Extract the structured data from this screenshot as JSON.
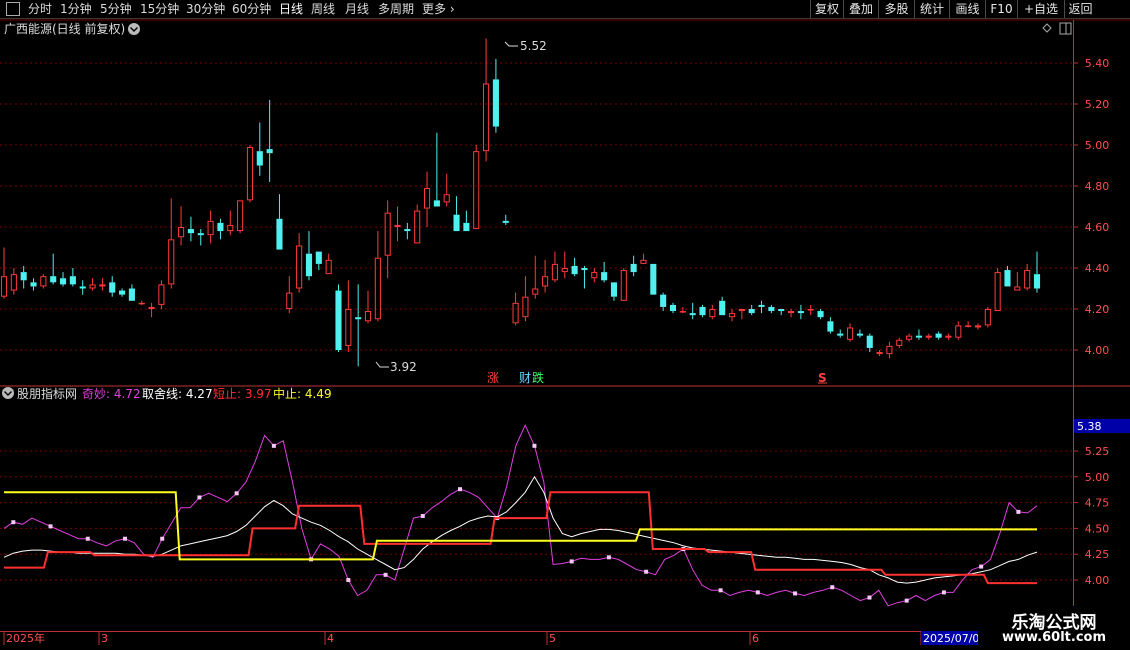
{
  "toolbar": {
    "periods": [
      "分时",
      "1分钟",
      "5分钟",
      "15分钟",
      "30分钟",
      "60分钟",
      "日线",
      "周线",
      "月线",
      "多周期"
    ],
    "active_period": "日线",
    "more": "更多",
    "right_buttons": [
      "复权",
      "叠加",
      "多股",
      "统计",
      "画线",
      "F10",
      "+自选",
      "返回"
    ]
  },
  "stock": {
    "title": "广西能源(日线 前复权)"
  },
  "indicator": {
    "name": "股朋指标网",
    "lines": [
      {
        "label": "奇妙: 4.72",
        "color": "#e040e0"
      },
      {
        "label": "取舍线: 4.27",
        "color": "#ffffff"
      },
      {
        "label": "短止: 3.97",
        "color": "#ff3030"
      },
      {
        "label": "中止: 4.49",
        "color": "#ffff20"
      }
    ],
    "current_value": "5.38"
  },
  "colors": {
    "up": "#ff3b3b",
    "down": "#4ef0f0",
    "grid": "#7a0000",
    "axis": "#c03030",
    "price_axis_text": "#ff5050"
  },
  "price_axis": {
    "labels": [
      "5.40",
      "5.20",
      "5.00",
      "4.80",
      "4.60",
      "4.40",
      "4.20",
      "4.00"
    ],
    "values": [
      5.4,
      5.2,
      5.0,
      4.8,
      4.6,
      4.4,
      4.2,
      4.0
    ]
  },
  "indicator_axis": {
    "labels": [
      "5.25",
      "5.00",
      "4.75",
      "4.50",
      "4.25",
      "4.00"
    ],
    "values": [
      5.25,
      5.0,
      4.75,
      4.5,
      4.25,
      4.0
    ]
  },
  "annotations": {
    "high": "5.52",
    "low": "3.92",
    "zhang": "涨",
    "cai": "财",
    "die": "跌",
    "s_mark": "S"
  },
  "date_axis": {
    "labels": [
      "2025年",
      "3",
      "4",
      "5",
      "6",
      "2025/07/0"
    ]
  },
  "watermark": {
    "line1": "乐淘公式网",
    "line2": "www.60lt.com"
  },
  "chart_data": {
    "type": "candlestick",
    "ylim": [
      3.85,
      5.57
    ],
    "candles": [
      {
        "o": 4.26,
        "h": 4.5,
        "l": 4.25,
        "c": 4.36
      },
      {
        "o": 4.29,
        "h": 4.4,
        "l": 4.27,
        "c": 4.37
      },
      {
        "o": 4.38,
        "h": 4.41,
        "l": 4.3,
        "c": 4.34
      },
      {
        "o": 4.33,
        "h": 4.35,
        "l": 4.29,
        "c": 4.31
      },
      {
        "o": 4.31,
        "h": 4.37,
        "l": 4.3,
        "c": 4.36
      },
      {
        "o": 4.36,
        "h": 4.47,
        "l": 4.32,
        "c": 4.33
      },
      {
        "o": 4.35,
        "h": 4.38,
        "l": 4.31,
        "c": 4.32
      },
      {
        "o": 4.36,
        "h": 4.4,
        "l": 4.31,
        "c": 4.32
      },
      {
        "o": 4.31,
        "h": 4.34,
        "l": 4.27,
        "c": 4.3
      },
      {
        "o": 4.3,
        "h": 4.35,
        "l": 4.29,
        "c": 4.32
      },
      {
        "o": 4.31,
        "h": 4.35,
        "l": 4.29,
        "c": 4.32
      },
      {
        "o": 4.33,
        "h": 4.36,
        "l": 4.26,
        "c": 4.28
      },
      {
        "o": 4.29,
        "h": 4.3,
        "l": 4.26,
        "c": 4.27
      },
      {
        "o": 4.3,
        "h": 4.32,
        "l": 4.24,
        "c": 4.24
      },
      {
        "o": 4.23,
        "h": 4.24,
        "l": 4.22,
        "c": 4.23
      },
      {
        "o": 4.2,
        "h": 4.23,
        "l": 4.16,
        "c": 4.21
      },
      {
        "o": 4.22,
        "h": 4.34,
        "l": 4.2,
        "c": 4.32
      },
      {
        "o": 4.32,
        "h": 4.74,
        "l": 4.3,
        "c": 4.54
      },
      {
        "o": 4.55,
        "h": 4.7,
        "l": 4.51,
        "c": 4.6
      },
      {
        "o": 4.59,
        "h": 4.65,
        "l": 4.53,
        "c": 4.57
      },
      {
        "o": 4.57,
        "h": 4.59,
        "l": 4.51,
        "c": 4.56
      },
      {
        "o": 4.56,
        "h": 4.68,
        "l": 4.52,
        "c": 4.63
      },
      {
        "o": 4.62,
        "h": 4.64,
        "l": 4.54,
        "c": 4.58
      },
      {
        "o": 4.58,
        "h": 4.68,
        "l": 4.56,
        "c": 4.61
      },
      {
        "o": 4.58,
        "h": 4.73,
        "l": 4.57,
        "c": 4.73
      },
      {
        "o": 4.73,
        "h": 5.0,
        "l": 4.72,
        "c": 4.99
      },
      {
        "o": 4.97,
        "h": 5.11,
        "l": 4.85,
        "c": 4.9
      },
      {
        "o": 4.98,
        "h": 5.22,
        "l": 4.82,
        "c": 4.96
      },
      {
        "o": 4.64,
        "h": 4.76,
        "l": 4.5,
        "c": 4.49
      },
      {
        "o": 4.2,
        "h": 4.36,
        "l": 4.18,
        "c": 4.28
      },
      {
        "o": 4.3,
        "h": 4.57,
        "l": 4.28,
        "c": 4.51
      },
      {
        "o": 4.47,
        "h": 4.58,
        "l": 4.34,
        "c": 4.36
      },
      {
        "o": 4.48,
        "h": 4.48,
        "l": 4.39,
        "c": 4.42
      },
      {
        "o": 4.37,
        "h": 4.47,
        "l": 4.37,
        "c": 4.44
      },
      {
        "o": 4.29,
        "h": 4.32,
        "l": 3.99,
        "c": 4.0
      },
      {
        "o": 4.02,
        "h": 4.34,
        "l": 3.99,
        "c": 4.2
      },
      {
        "o": 4.16,
        "h": 4.32,
        "l": 3.92,
        "c": 4.15
      },
      {
        "o": 4.14,
        "h": 4.29,
        "l": 4.13,
        "c": 4.19
      },
      {
        "o": 4.15,
        "h": 4.58,
        "l": 4.14,
        "c": 4.45
      },
      {
        "o": 4.46,
        "h": 4.73,
        "l": 4.35,
        "c": 4.67
      },
      {
        "o": 4.6,
        "h": 4.7,
        "l": 4.53,
        "c": 4.61
      },
      {
        "o": 4.59,
        "h": 4.62,
        "l": 4.54,
        "c": 4.58
      },
      {
        "o": 4.52,
        "h": 4.71,
        "l": 4.52,
        "c": 4.68
      },
      {
        "o": 4.69,
        "h": 4.87,
        "l": 4.6,
        "c": 4.79
      },
      {
        "o": 4.73,
        "h": 5.06,
        "l": 4.7,
        "c": 4.7
      },
      {
        "o": 4.72,
        "h": 4.86,
        "l": 4.7,
        "c": 4.76
      },
      {
        "o": 4.66,
        "h": 4.75,
        "l": 4.58,
        "c": 4.58
      },
      {
        "o": 4.62,
        "h": 4.68,
        "l": 4.58,
        "c": 4.58
      },
      {
        "o": 4.59,
        "h": 5.0,
        "l": 4.59,
        "c": 4.97
      },
      {
        "o": 4.97,
        "h": 5.52,
        "l": 4.92,
        "c": 5.3
      },
      {
        "o": 5.32,
        "h": 5.42,
        "l": 5.06,
        "c": 5.09
      },
      {
        "o": 4.63,
        "h": 4.66,
        "l": 4.61,
        "c": 4.62
      },
      {
        "o": 4.13,
        "h": 4.28,
        "l": 4.12,
        "c": 4.23
      },
      {
        "o": 4.16,
        "h": 4.36,
        "l": 4.14,
        "c": 4.26
      },
      {
        "o": 4.27,
        "h": 4.46,
        "l": 4.25,
        "c": 4.3
      },
      {
        "o": 4.31,
        "h": 4.44,
        "l": 4.28,
        "c": 4.36
      },
      {
        "o": 4.34,
        "h": 4.48,
        "l": 4.33,
        "c": 4.42
      },
      {
        "o": 4.38,
        "h": 4.48,
        "l": 4.35,
        "c": 4.4
      },
      {
        "o": 4.41,
        "h": 4.45,
        "l": 4.36,
        "c": 4.37
      },
      {
        "o": 4.4,
        "h": 4.41,
        "l": 4.3,
        "c": 4.39
      },
      {
        "o": 4.35,
        "h": 4.4,
        "l": 4.33,
        "c": 4.38
      },
      {
        "o": 4.38,
        "h": 4.43,
        "l": 4.33,
        "c": 4.34
      },
      {
        "o": 4.33,
        "h": 4.33,
        "l": 4.24,
        "c": 4.26
      },
      {
        "o": 4.24,
        "h": 4.4,
        "l": 4.24,
        "c": 4.39
      },
      {
        "o": 4.42,
        "h": 4.46,
        "l": 4.36,
        "c": 4.38
      },
      {
        "o": 4.42,
        "h": 4.47,
        "l": 4.42,
        "c": 4.44
      },
      {
        "o": 4.42,
        "h": 4.42,
        "l": 4.27,
        "c": 4.27
      },
      {
        "o": 4.27,
        "h": 4.28,
        "l": 4.19,
        "c": 4.21
      },
      {
        "o": 4.22,
        "h": 4.23,
        "l": 4.18,
        "c": 4.19
      },
      {
        "o": 4.19,
        "h": 4.21,
        "l": 4.18,
        "c": 4.19
      },
      {
        "o": 4.18,
        "h": 4.23,
        "l": 4.15,
        "c": 4.17
      },
      {
        "o": 4.21,
        "h": 4.22,
        "l": 4.16,
        "c": 4.17
      },
      {
        "o": 4.16,
        "h": 4.22,
        "l": 4.15,
        "c": 4.2
      },
      {
        "o": 4.24,
        "h": 4.26,
        "l": 4.17,
        "c": 4.17
      },
      {
        "o": 4.16,
        "h": 4.2,
        "l": 4.14,
        "c": 4.18
      },
      {
        "o": 4.19,
        "h": 4.2,
        "l": 4.15,
        "c": 4.2
      },
      {
        "o": 4.2,
        "h": 4.22,
        "l": 4.17,
        "c": 4.18
      },
      {
        "o": 4.22,
        "h": 4.24,
        "l": 4.18,
        "c": 4.21
      },
      {
        "o": 4.21,
        "h": 4.22,
        "l": 4.18,
        "c": 4.19
      },
      {
        "o": 4.2,
        "h": 4.2,
        "l": 4.17,
        "c": 4.19
      },
      {
        "o": 4.18,
        "h": 4.2,
        "l": 4.16,
        "c": 4.19
      },
      {
        "o": 4.19,
        "h": 4.22,
        "l": 4.15,
        "c": 4.18
      },
      {
        "o": 4.2,
        "h": 4.22,
        "l": 4.17,
        "c": 4.2
      },
      {
        "o": 4.19,
        "h": 4.2,
        "l": 4.15,
        "c": 4.16
      },
      {
        "o": 4.14,
        "h": 4.16,
        "l": 4.08,
        "c": 4.09
      },
      {
        "o": 4.08,
        "h": 4.1,
        "l": 4.06,
        "c": 4.07
      },
      {
        "o": 4.05,
        "h": 4.13,
        "l": 4.04,
        "c": 4.11
      },
      {
        "o": 4.08,
        "h": 4.1,
        "l": 4.06,
        "c": 4.07
      },
      {
        "o": 4.07,
        "h": 4.08,
        "l": 3.99,
        "c": 4.01
      },
      {
        "o": 3.98,
        "h": 4.0,
        "l": 3.97,
        "c": 3.99
      },
      {
        "o": 3.98,
        "h": 4.04,
        "l": 3.96,
        "c": 4.02
      },
      {
        "o": 4.02,
        "h": 4.06,
        "l": 4.01,
        "c": 4.05
      },
      {
        "o": 4.05,
        "h": 4.08,
        "l": 4.04,
        "c": 4.07
      },
      {
        "o": 4.07,
        "h": 4.1,
        "l": 4.05,
        "c": 4.06
      },
      {
        "o": 4.06,
        "h": 4.08,
        "l": 4.05,
        "c": 4.07
      },
      {
        "o": 4.08,
        "h": 4.09,
        "l": 4.05,
        "c": 4.06
      },
      {
        "o": 4.06,
        "h": 4.08,
        "l": 4.05,
        "c": 4.07
      },
      {
        "o": 4.06,
        "h": 4.14,
        "l": 4.05,
        "c": 4.12
      },
      {
        "o": 4.12,
        "h": 4.14,
        "l": 4.11,
        "c": 4.12
      },
      {
        "o": 4.11,
        "h": 4.13,
        "l": 4.1,
        "c": 4.12
      },
      {
        "o": 4.12,
        "h": 4.21,
        "l": 4.11,
        "c": 4.2
      },
      {
        "o": 4.19,
        "h": 4.4,
        "l": 4.19,
        "c": 4.38
      },
      {
        "o": 4.39,
        "h": 4.41,
        "l": 4.31,
        "c": 4.31
      },
      {
        "o": 4.29,
        "h": 4.38,
        "l": 4.29,
        "c": 4.31
      },
      {
        "o": 4.3,
        "h": 4.42,
        "l": 4.29,
        "c": 4.39
      },
      {
        "o": 4.37,
        "h": 4.48,
        "l": 4.28,
        "c": 4.3
      }
    ],
    "indicator_ylim": [
      3.75,
      5.57
    ],
    "series": [
      {
        "name": "奇妙",
        "color": "#e040e0",
        "values": [
          4.5,
          4.56,
          4.54,
          4.6,
          4.56,
          4.52,
          4.48,
          4.44,
          4.4,
          4.4,
          4.36,
          4.33,
          4.38,
          4.4,
          4.36,
          4.25,
          4.22,
          4.4,
          4.55,
          4.7,
          4.7,
          4.8,
          4.84,
          4.8,
          4.76,
          4.84,
          4.95,
          5.15,
          5.4,
          5.3,
          5.35,
          4.95,
          4.5,
          4.2,
          4.35,
          4.3,
          4.23,
          4.0,
          3.85,
          3.9,
          4.05,
          4.05,
          4.0,
          4.3,
          4.6,
          4.62,
          4.7,
          4.76,
          4.83,
          4.88,
          4.85,
          4.8,
          4.7,
          4.6,
          4.9,
          5.3,
          5.5,
          5.3,
          4.95,
          4.15,
          4.16,
          4.18,
          4.21,
          4.2,
          4.2,
          4.22,
          4.2,
          4.15,
          4.1,
          4.08,
          4.05,
          4.2,
          4.24,
          4.3,
          4.1,
          3.95,
          3.9,
          3.9,
          3.85,
          3.88,
          3.9,
          3.88,
          3.85,
          3.88,
          3.9,
          3.87,
          3.85,
          3.88,
          3.9,
          3.93,
          3.9,
          3.85,
          3.8,
          3.83,
          3.9,
          3.75,
          3.78,
          3.8,
          3.85,
          3.8,
          3.85,
          3.88,
          3.88,
          4.0,
          4.1,
          4.13,
          4.2,
          4.45,
          4.75,
          4.66,
          4.65,
          4.72
        ]
      },
      {
        "name": "取舍线",
        "color": "#ffffff",
        "values": [
          4.22,
          4.26,
          4.28,
          4.29,
          4.29,
          4.28,
          4.27,
          4.27,
          4.26,
          4.26,
          4.26,
          4.26,
          4.26,
          4.25,
          4.25,
          4.24,
          4.23,
          4.25,
          4.29,
          4.33,
          4.35,
          4.37,
          4.39,
          4.41,
          4.43,
          4.47,
          4.53,
          4.62,
          4.71,
          4.77,
          4.72,
          4.64,
          4.6,
          4.56,
          4.53,
          4.48,
          4.42,
          4.37,
          4.3,
          4.25,
          4.2,
          4.15,
          4.1,
          4.12,
          4.2,
          4.3,
          4.37,
          4.43,
          4.48,
          4.52,
          4.57,
          4.6,
          4.62,
          4.61,
          4.66,
          4.75,
          4.85,
          5.0,
          4.85,
          4.6,
          4.45,
          4.42,
          4.45,
          4.47,
          4.49,
          4.49,
          4.48,
          4.46,
          4.44,
          4.42,
          4.4,
          4.38,
          4.36,
          4.33,
          4.31,
          4.3,
          4.29,
          4.28,
          4.27,
          4.26,
          4.25,
          4.24,
          4.23,
          4.22,
          4.22,
          4.21,
          4.2,
          4.2,
          4.19,
          4.18,
          4.17,
          4.15,
          4.12,
          4.1,
          4.05,
          4.02,
          3.98,
          3.97,
          3.98,
          4.0,
          4.02,
          4.03,
          4.04,
          4.05,
          4.06,
          4.08,
          4.1,
          4.14,
          4.18,
          4.2,
          4.24,
          4.27
        ]
      },
      {
        "name": "短止",
        "color": "#ff3030",
        "values": [
          4.12,
          4.12,
          4.12,
          4.12,
          4.12,
          4.27,
          4.27,
          4.27,
          4.27,
          4.27,
          4.24,
          4.24,
          4.24,
          4.24,
          4.24,
          4.24,
          4.24,
          4.24,
          4.24,
          4.24,
          4.24,
          4.24,
          4.24,
          4.24,
          4.24,
          4.24,
          4.24,
          4.5,
          4.5,
          4.5,
          4.5,
          4.5,
          4.72,
          4.72,
          4.72,
          4.72,
          4.72,
          4.72,
          4.72,
          4.35,
          4.35,
          4.35,
          4.35,
          4.35,
          4.35,
          4.35,
          4.35,
          4.35,
          4.35,
          4.35,
          4.35,
          4.35,
          4.35,
          4.6,
          4.6,
          4.6,
          4.6,
          4.6,
          4.6,
          4.85,
          4.85,
          4.85,
          4.85,
          4.85,
          4.85,
          4.85,
          4.85,
          4.85,
          4.85,
          4.85,
          4.3,
          4.3,
          4.3,
          4.3,
          4.3,
          4.3,
          4.27,
          4.27,
          4.27,
          4.27,
          4.27,
          4.1,
          4.1,
          4.1,
          4.1,
          4.1,
          4.1,
          4.1,
          4.1,
          4.1,
          4.1,
          4.1,
          4.1,
          4.1,
          4.1,
          4.05,
          4.05,
          4.05,
          4.05,
          4.05,
          4.05,
          4.05,
          4.05,
          4.05,
          4.05,
          4.05,
          3.97,
          3.97,
          3.97,
          3.97,
          3.97,
          3.97
        ]
      },
      {
        "name": "中止",
        "color": "#ffff20",
        "values": [
          4.85,
          4.85,
          4.85,
          4.85,
          4.85,
          4.85,
          4.85,
          4.85,
          4.85,
          4.85,
          4.85,
          4.85,
          4.85,
          4.85,
          4.85,
          4.85,
          4.85,
          4.85,
          4.85,
          4.2,
          4.2,
          4.2,
          4.2,
          4.2,
          4.2,
          4.2,
          4.2,
          4.2,
          4.2,
          4.2,
          4.2,
          4.2,
          4.2,
          4.2,
          4.2,
          4.2,
          4.2,
          4.2,
          4.2,
          4.2,
          4.38,
          4.38,
          4.38,
          4.38,
          4.38,
          4.38,
          4.38,
          4.38,
          4.38,
          4.38,
          4.38,
          4.38,
          4.38,
          4.38,
          4.38,
          4.38,
          4.38,
          4.38,
          4.38,
          4.38,
          4.38,
          4.38,
          4.38,
          4.38,
          4.38,
          4.38,
          4.38,
          4.38,
          4.49,
          4.49,
          4.49,
          4.49,
          4.49,
          4.49,
          4.49,
          4.49,
          4.49,
          4.49,
          4.49,
          4.49,
          4.49,
          4.49,
          4.49,
          4.49,
          4.49,
          4.49,
          4.49,
          4.49,
          4.49,
          4.49,
          4.49,
          4.49,
          4.49,
          4.49,
          4.49,
          4.49,
          4.49,
          4.49,
          4.49,
          4.49,
          4.49,
          4.49,
          4.49,
          4.49,
          4.49,
          4.49,
          4.49,
          4.49,
          4.49,
          4.49,
          4.49
        ]
      }
    ]
  }
}
